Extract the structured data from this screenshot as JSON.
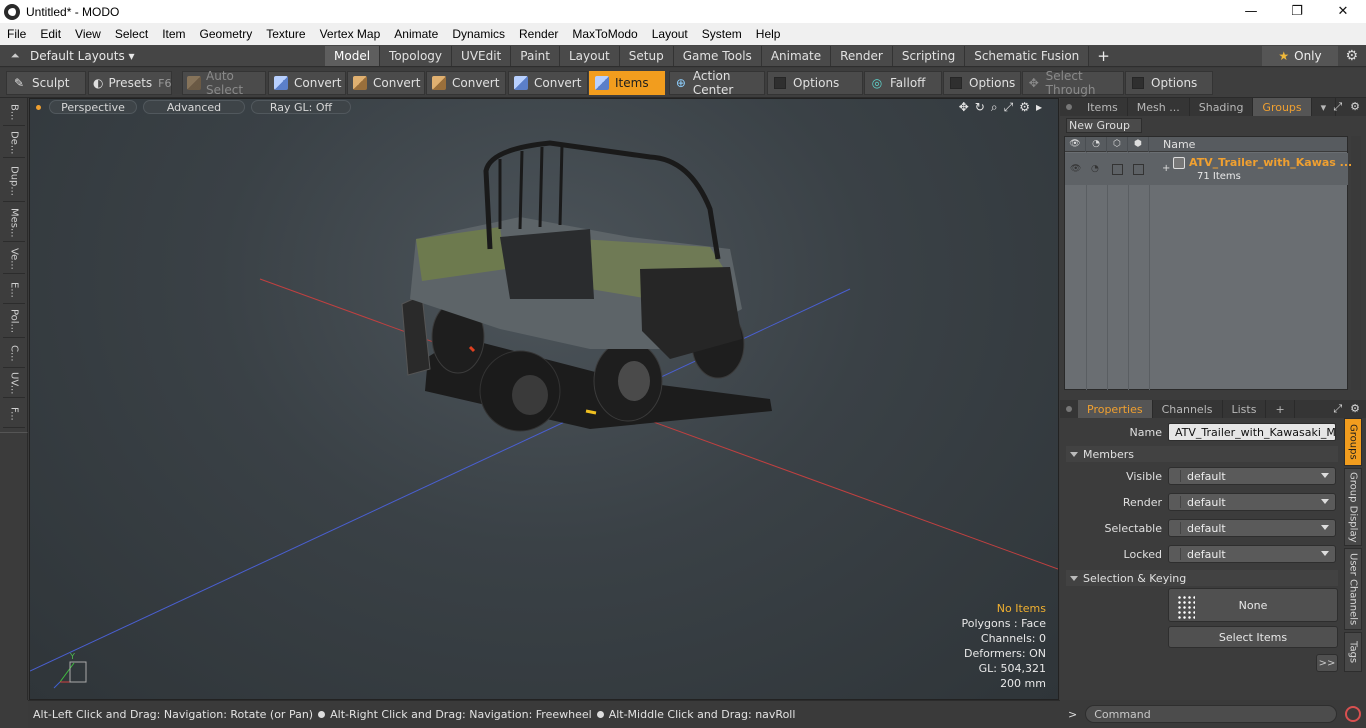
{
  "window": {
    "title": "Untitled* - MODO",
    "minimize": "—",
    "maximize": "❐",
    "close": "✕"
  },
  "menu": [
    "File",
    "Edit",
    "View",
    "Select",
    "Item",
    "Geometry",
    "Texture",
    "Vertex Map",
    "Animate",
    "Dynamics",
    "Render",
    "MaxToModo",
    "Layout",
    "System",
    "Help"
  ],
  "layoutbar": {
    "layouts_label": "Default Layouts ▾",
    "tabs": [
      "Model",
      "Topology",
      "UVEdit",
      "Paint",
      "Layout",
      "Setup",
      "Game Tools",
      "Animate",
      "Render",
      "Scripting",
      "Schematic Fusion"
    ],
    "active_tab": "Model",
    "plus": "+",
    "only": "Only",
    "star": "★",
    "gear": "⚙"
  },
  "toolbar": {
    "sculpt": "Sculpt",
    "presets": "Presets",
    "presets_key": "F6",
    "auto_select": "Auto Select",
    "convert": "Convert",
    "items": "Items",
    "action_center": "Action Center",
    "options": "Options",
    "falloff": "Falloff",
    "select_through": "Select Through"
  },
  "leftbar": [
    "B...",
    "De...",
    "Dup...",
    "Mes...",
    "Ve...",
    "E...",
    "Pol...",
    "C...",
    "UV...",
    "F..."
  ],
  "viewport": {
    "perspective": "Perspective",
    "advanced": "Advanced",
    "raygl": "Ray GL: Off",
    "icons": [
      "✥",
      "↻",
      "⌕",
      "⤢",
      "⚙",
      "▸"
    ],
    "stats": {
      "no_items": "No Items",
      "polygons": "Polygons : Face",
      "channels": "Channels: 0",
      "deformers": "Deformers: ON",
      "gl": "GL: 504,321",
      "scale": "200 mm"
    },
    "axis_y": "Y",
    "axis_x": "X",
    "axis_z": "Z"
  },
  "statusbar": {
    "hint1": "Alt-Left Click and Drag: Navigation: Rotate (or Pan)",
    "hint2": "Alt-Right Click and Drag: Navigation: Freewheel",
    "hint3": "Alt-Middle Click and Drag: navRoll"
  },
  "right_tabs": {
    "items": "Items",
    "mesh": "Mesh ...",
    "shading": "Shading",
    "groups": "Groups"
  },
  "groups": {
    "new_group": "New Group",
    "name_header": "Name",
    "row": {
      "name": "ATV_Trailer_with_Kawas ...",
      "count": "71 Items",
      "expand": "+"
    }
  },
  "prop_tabs": {
    "properties": "Properties",
    "channels": "Channels",
    "lists": "Lists",
    "plus": "+"
  },
  "properties": {
    "name_label": "Name",
    "name_value": "ATV_Trailer_with_Kawasaki_Mule",
    "members_section": "Members",
    "visible_label": "Visible",
    "render_label": "Render",
    "selectable_label": "Selectable",
    "locked_label": "Locked",
    "default_value": "default",
    "selection_section": "Selection & Keying",
    "none_label": "None",
    "select_items": "Select Items",
    "more": ">>"
  },
  "right_vtabs": [
    "Groups",
    "Group Display",
    "User Channels",
    "Tags"
  ],
  "cmdbar": {
    "prompt": ">",
    "placeholder": "Command"
  }
}
